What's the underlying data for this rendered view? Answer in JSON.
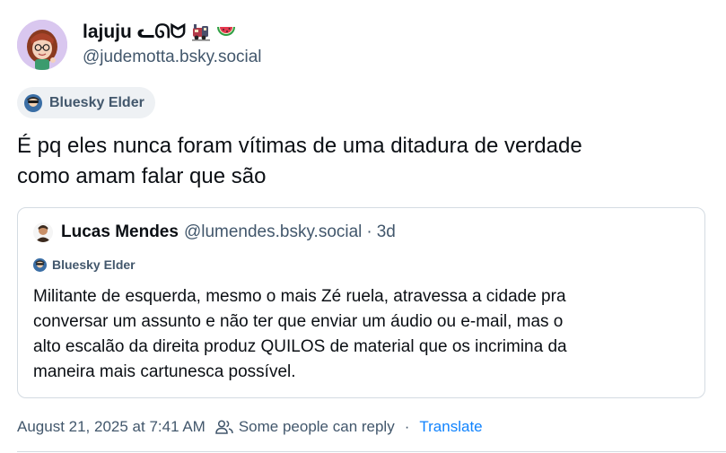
{
  "post": {
    "author": {
      "display_name": "lajuju ᓚᘏᗢ",
      "handle": "@judemotta.bsky.social",
      "avatar_icon": "cartoon-avatar-icon",
      "emojis": [
        "train-emoji-icon",
        "watermelon-emoji-icon"
      ]
    },
    "badge": {
      "label": "Bluesky Elder",
      "icon": "elder-avatar-icon"
    },
    "text_lines": [
      "É pq eles nunca foram vítimas de uma ditadura de verdade",
      "como amam falar que são"
    ],
    "quote": {
      "author_name": "Lucas Mendes",
      "handle": "@lumendes.bsky.social",
      "separator": "·",
      "time": "3d",
      "badge_label": "Bluesky Elder",
      "text_lines": [
        "Militante de esquerda, mesmo o mais Zé ruela, atravessa a cidade pra",
        "conversar um assunto e não ter que enviar um áudio ou e-mail, mas o",
        "alto escalão da direita produz QUILOS de material que os incrimina da",
        "maneira mais cartunesca possível."
      ]
    },
    "meta": {
      "timestamp": "August 21, 2025 at 7:41 AM",
      "reply_setting": "Some people can reply",
      "separator": "·",
      "translate_label": "Translate"
    }
  },
  "colors": {
    "text": "#0b0f14",
    "muted": "#42576c",
    "link": "#1083fe",
    "border": "#d4dbe2",
    "badge_bg": "#eef1f4"
  }
}
